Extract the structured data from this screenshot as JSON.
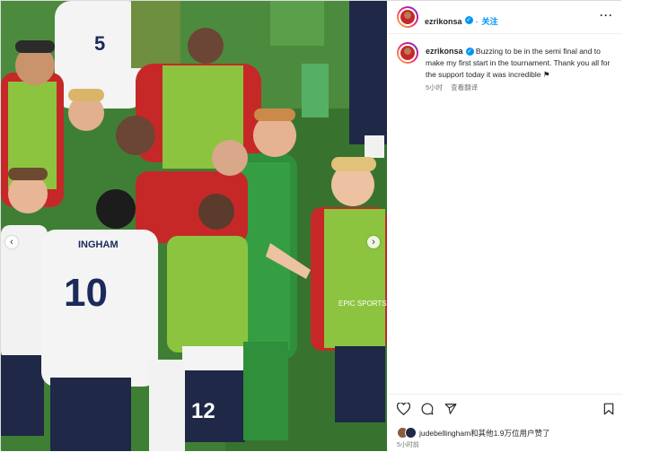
{
  "post": {
    "username": "ezrikonsa",
    "follow_label": "关注",
    "caption": "Buzzing to be in the semi final and to make my first start in the tournament. Thank you all for the support today it was incredible",
    "caption_emoji": "⚑",
    "time_ago": "5小时",
    "translate_label": "查看翻译",
    "likes_text": "judebellingham和其他1.9万位用户赞了",
    "post_time": "5小时前",
    "more_icon": "more-options-icon"
  },
  "photo": {
    "jersey_numbers": [
      "5",
      "10",
      "12"
    ],
    "jersey_name": "INGHAM",
    "sponsor_text": "EPIC SPORTS"
  },
  "colors": {
    "accent": "#0095f6",
    "muted": "#737373",
    "text": "#262626"
  }
}
